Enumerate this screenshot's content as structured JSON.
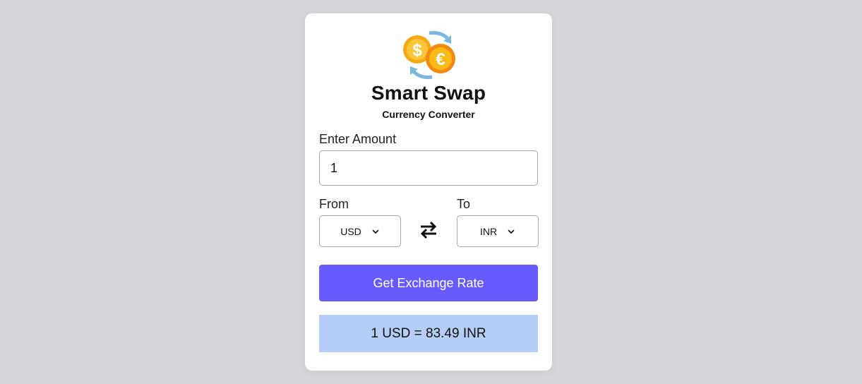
{
  "app": {
    "title": "Smart Swap",
    "subtitle": "Currency Converter"
  },
  "amount": {
    "label": "Enter Amount",
    "value": "1"
  },
  "from": {
    "label": "From",
    "selected": "USD"
  },
  "to": {
    "label": "To",
    "selected": "INR"
  },
  "button": {
    "label": "Get Exchange Rate"
  },
  "result": {
    "text": "1 USD = 83.49 INR"
  },
  "colors": {
    "background": "#d4d5da",
    "button": "#675afe",
    "result": "#b6cef6",
    "coin_gold": "#f9b916",
    "coin_orange": "#f5880f",
    "arrow_blue": "#7cb9e0"
  },
  "icons": {
    "logo": "currency-exchange-icon",
    "swap": "swap-arrows-icon",
    "dropdown": "chevron-down-icon"
  }
}
